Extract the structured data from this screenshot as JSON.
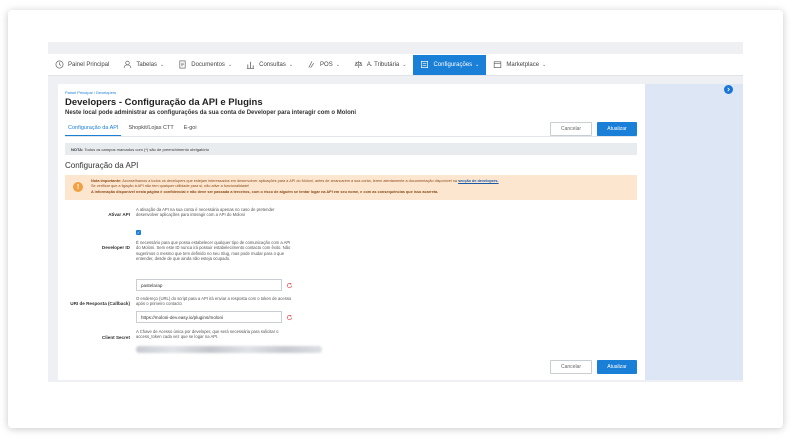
{
  "nav": {
    "items": [
      {
        "label": "Painel Principal",
        "icon": "clock-icon",
        "chevron": false
      },
      {
        "label": "Tabelas",
        "icon": "users-icon",
        "chevron": true
      },
      {
        "label": "Documentos",
        "icon": "document-icon",
        "chevron": true
      },
      {
        "label": "Consultas",
        "icon": "bar-chart-icon",
        "chevron": true
      },
      {
        "label": "POS",
        "icon": "pos-icon",
        "chevron": true
      },
      {
        "label": "A. Tributária",
        "icon": "scale-icon",
        "chevron": true
      },
      {
        "label": "Configurações",
        "icon": "settings-icon",
        "chevron": true,
        "active": true
      },
      {
        "label": "Marketplace",
        "icon": "marketplace-icon",
        "chevron": true
      }
    ],
    "chevron_glyph": "⌄"
  },
  "breadcrumb": {
    "home": "Painel Principal",
    "separator": "/",
    "current": "Developers"
  },
  "page": {
    "title": "Developers - Configuração da API e Plugins",
    "subtitle": "Neste local pode administrar as configurações da sua conta de Developer para interagir com o Moloni"
  },
  "tabs": [
    "Configuração da API",
    "Shopkit/Lojas CTT",
    "E-goi"
  ],
  "buttons": {
    "cancel": "Cancelar",
    "save": "Atualizar"
  },
  "note": {
    "label": "NOTA:",
    "text": "Todos os campos marcados com (*) são de preenchimento obrigatório"
  },
  "section": {
    "title": "Configuração da API"
  },
  "warning": {
    "label": "Nota importante:",
    "line1": "Aconselhamos a todos os developers que estejam interessados em desenvolver aplicações para a API do Moloni, antes de arrancarem a sua conta, lerem atentamente a documentação disponível na",
    "link": "secção de developers.",
    "line2": "Se verificar que a ligação à API não tem qualquer utilidade para si, não ative a funcionalidade!",
    "line3": "A informação disponível nesta página é confidencial e não deve ser passada a terceiros, com o risco de alguém se tentar logar na API em seu nome, e com as consequências que isso acarreta."
  },
  "form": {
    "activate": {
      "label": "Ativar API",
      "help": "A ativação da API na sua conta é necessária apenas no caso de pretender desenvolver aplicações para interagir com a API do Moloni"
    },
    "developer_id": {
      "label": "Developer ID",
      "help": "É necessário para que possa estabelecer qualquer tipo de comunicação com a API do Moloni. Sem este ID nunca irá possuir estabelecimento contacto com êxito. Não sugerimos o mesmo que tem definido no seu Slug, mas pode mudar para o que entender, desde de que ainda não esteja ocupado.",
      "value": "pastelarap"
    },
    "callback": {
      "label": "URI de Resposta (Callback)",
      "help": "O endereço (URL) do script para a API irá enviar a resposta com o token de acesso após o primeiro contacto",
      "value": "https://moloni-dev.easy.io/plugins/moloni"
    },
    "client_secret": {
      "label": "Client Secret",
      "help": "A Chave de Acesso única por developer, que será necessária para solicitar o access_token cada vez que se logar na API."
    }
  },
  "colors": {
    "accent": "#1a7fd6",
    "warning_bg": "#fde6cf",
    "warning_icon": "#f0a040",
    "sidebar": "#dce6f5",
    "required": "#e05050"
  }
}
